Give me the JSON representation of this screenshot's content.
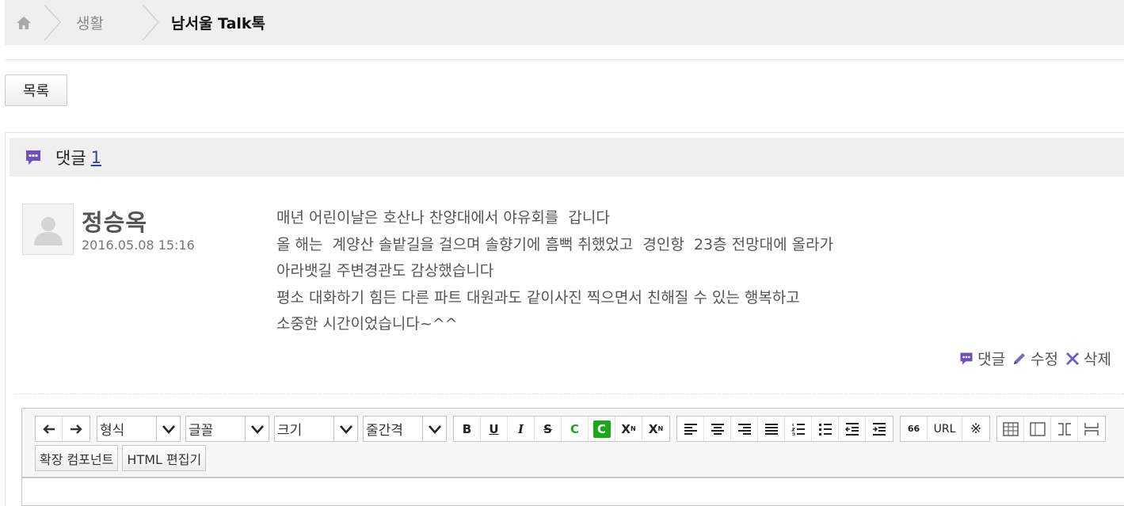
{
  "breadcrumb": {
    "home": "home",
    "items": [
      "생활",
      "남서울 Talk톡"
    ]
  },
  "list_button": "목록",
  "comments": {
    "label": "댓글",
    "count": "1",
    "items": [
      {
        "author": "정승옥",
        "date": "2016.05.08 15:16",
        "lines": [
          "매년 어린이날은 호산나 찬양대에서 야유회를  갑니다",
          "올 해는  계양산 솔밭길을 걸으며 솔향기에 흠뻑 취했었고  경인항  23층 전망대에 올라가",
          "아라뱃길 주변경관도 감상했습니다",
          "평소 대화하기 힘든 다른 파트 대원과도 같이사진 찍으면서 친해질 수 있는 행복하고",
          "소중한 시간이었습니다~^^"
        ],
        "actions": {
          "reply": "댓글",
          "edit": "수정",
          "delete": "삭제"
        }
      }
    ]
  },
  "editor": {
    "selects": {
      "format": "형식",
      "font": "글꼴",
      "size": "크기",
      "line_height": "줄간격"
    },
    "format_buttons": {
      "bold": "B",
      "underline": "U",
      "italic": "I",
      "strike": "S",
      "color": "C",
      "bgcolor": "C",
      "sup": "X",
      "sup_mark": "N",
      "sub": "X",
      "sub_mark": "N"
    },
    "insert_buttons": {
      "quote": "66",
      "url": "URL",
      "special": "※"
    },
    "extension_button": "확장 컴포넌트",
    "html_button": "HTML 편집기"
  },
  "colors": {
    "accent_purple": "#6d4fc2",
    "green": "#1aa81a",
    "link": "#3344aa"
  }
}
